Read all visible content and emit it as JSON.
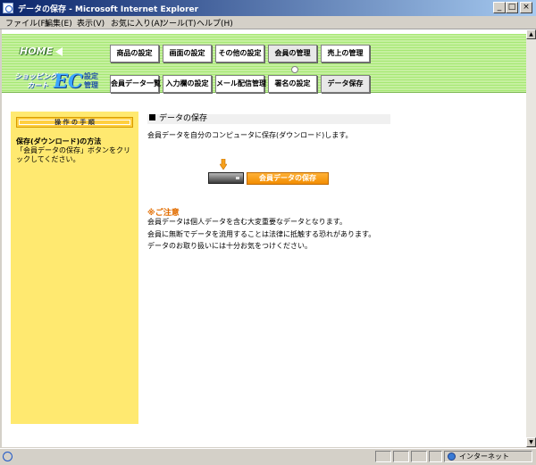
{
  "window": {
    "title": "データの保存 - Microsoft Internet Explorer",
    "minimize": "_",
    "maximize": "□",
    "close": "×"
  },
  "menu": [
    "ファイル(F)",
    "編集(E)",
    "表示(V)",
    "お気に入り(A)",
    "ツール(T)",
    "ヘルプ(H)"
  ],
  "header": {
    "home": "HOME",
    "logo": {
      "line1": "ショッピング",
      "line2": "カート",
      "ec": "EC",
      "line3": "設定",
      "line4": "管理"
    },
    "nav_top": [
      "商品の設定",
      "画面の設定",
      "その他の設定",
      "会員の管理",
      "売上の管理"
    ],
    "nav_bottom": [
      "会員データ一覧",
      "入力欄の設定",
      "メール配信管理",
      "署名の設定",
      "データ保存"
    ]
  },
  "left_panel": {
    "heading": "操 作 の 手 順",
    "title": "保存(ダウンロード)の方法",
    "text": "「会員データの保存」ボタンをクリックしてください。"
  },
  "main": {
    "section_title": "データの保存",
    "description": "会員データを自分のコンピュータに保存(ダウンロード)します。",
    "save_button": "会員データの保存",
    "note_title": "※ご注意",
    "notes": [
      "会員データは個人データを含む大変重要なデータとなります。",
      "会員に無断でデータを流用することは法律に抵触する恐れがあります。",
      "データのお取り扱いには十分お気をつけください。"
    ]
  },
  "status": {
    "zone": "インターネット"
  },
  "colors": {
    "header_green": "#b6ec88",
    "left_panel": "#ffe970",
    "save_button": "#f7a11c",
    "note_orange": "#e26d00"
  }
}
